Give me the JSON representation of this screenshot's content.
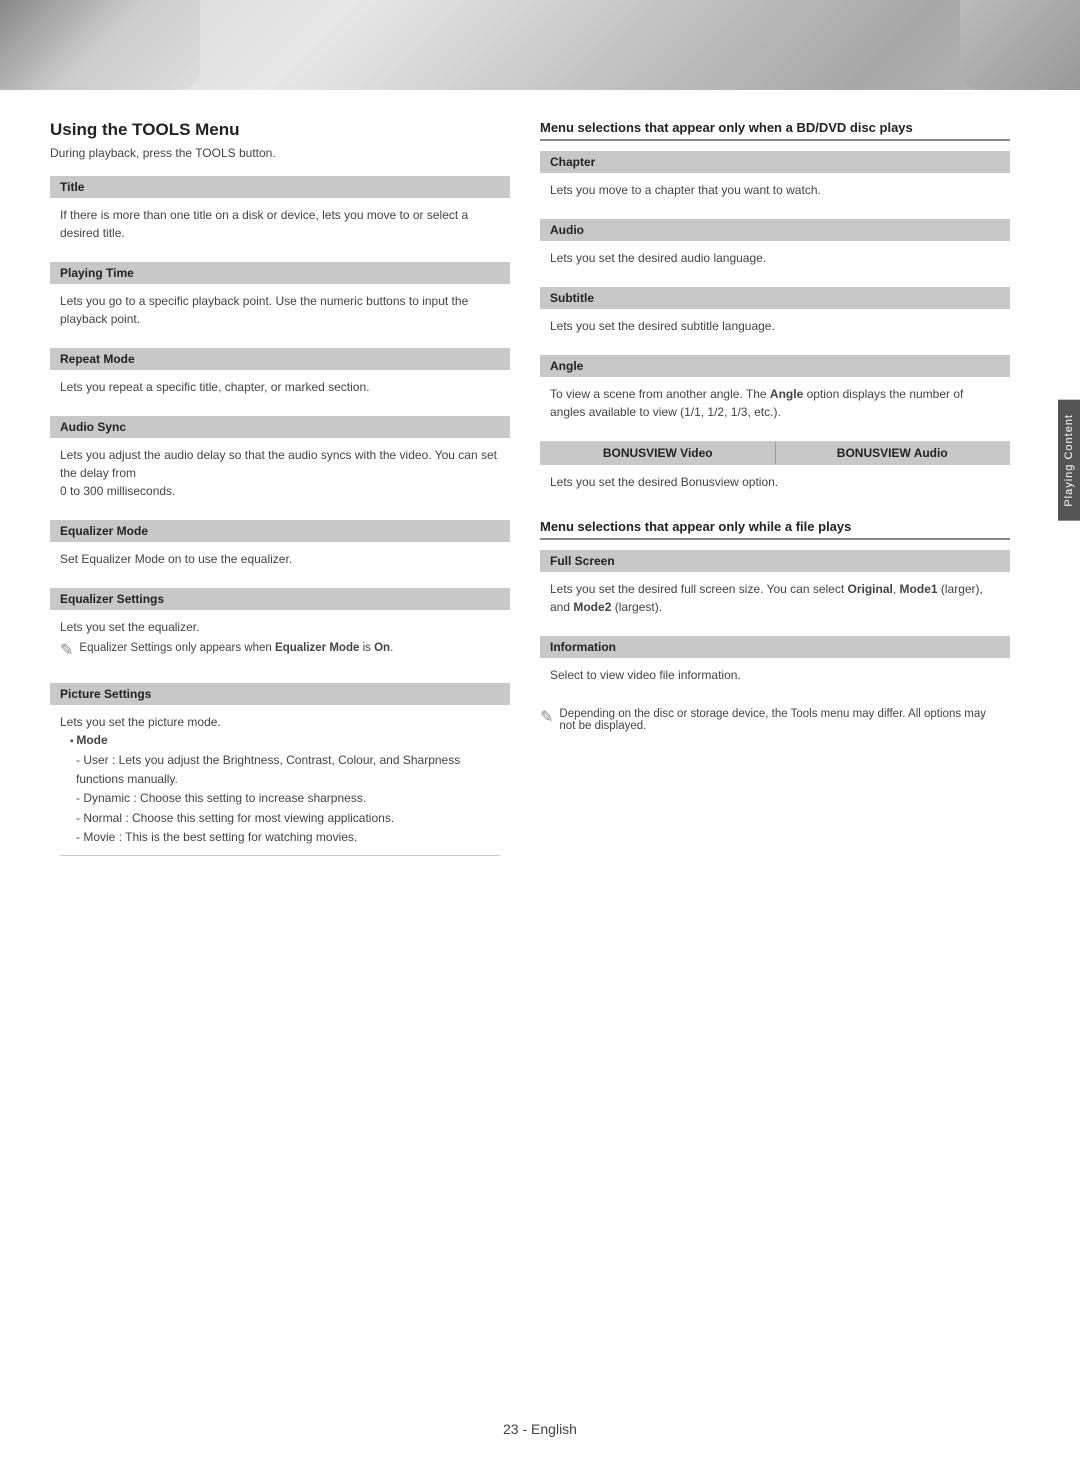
{
  "header": {
    "alt": "Header banner"
  },
  "side_tab": {
    "label": "Playing Content"
  },
  "left_column": {
    "title": "Using the TOOLS Menu",
    "subtitle": "During playback, press the TOOLS button.",
    "items": [
      {
        "label": "Title",
        "content": "If there is more than one title on a disk or device, lets you move to or select a desired title."
      },
      {
        "label": "Playing Time",
        "content": "Lets you go to a specific playback point. Use the numeric buttons to input the playback point."
      },
      {
        "label": "Repeat Mode",
        "content": "Lets you repeat a specific title, chapter, or marked section."
      },
      {
        "label": "Audio Sync",
        "content": "Lets you adjust the audio delay so that the audio syncs with the video. You can set the delay from\n0 to 300 milliseconds."
      },
      {
        "label": "Equalizer Mode",
        "content": "Set Equalizer Mode on to use the equalizer."
      },
      {
        "label": "Equalizer Settings",
        "content_main": "Lets you set the equalizer.",
        "note": "Equalizer Settings only appears when Equalizer Mode is On."
      },
      {
        "label": "Picture Settings",
        "content": "Lets you set the picture mode.",
        "mode_label": "Mode",
        "mode_items": [
          "User : Lets you adjust the Brightness, Contrast, Colour, and Sharpness functions manually.",
          "Dynamic : Choose this setting to increase sharpness.",
          "Normal : Choose this setting for most viewing applications.",
          "Movie : This is the best setting for watching movies."
        ]
      }
    ]
  },
  "right_column": {
    "section1_heading": "Menu selections that appear only when a BD/DVD disc plays",
    "section1_items": [
      {
        "label": "Chapter",
        "content": "Lets you move to a chapter that you want to watch."
      },
      {
        "label": "Audio",
        "content": "Lets you set the desired audio language."
      },
      {
        "label": "Subtitle",
        "content": "Lets you set the desired subtitle language."
      },
      {
        "label": "Angle",
        "content": "To view a scene from another angle. The Angle option displays the number of angles available to view (1/1, 1/2, 1/3, etc.)."
      }
    ],
    "bonusview_label1": "BONUSVIEW Video",
    "bonusview_label2": "BONUSVIEW Audio",
    "bonusview_content": "Lets you set the desired Bonusview option.",
    "section2_heading": "Menu selections that appear only while a file plays",
    "section2_items": [
      {
        "label": "Full Screen",
        "content": "Lets you set the desired full screen size. You can select Original, Mode1 (larger), and Mode2 (largest)."
      },
      {
        "label": "Information",
        "content": "Select to view video file information."
      }
    ],
    "note": "Depending on the disc or storage device, the Tools menu may differ. All options may not be displayed."
  },
  "footer": {
    "page_number": "23",
    "language": "English"
  }
}
